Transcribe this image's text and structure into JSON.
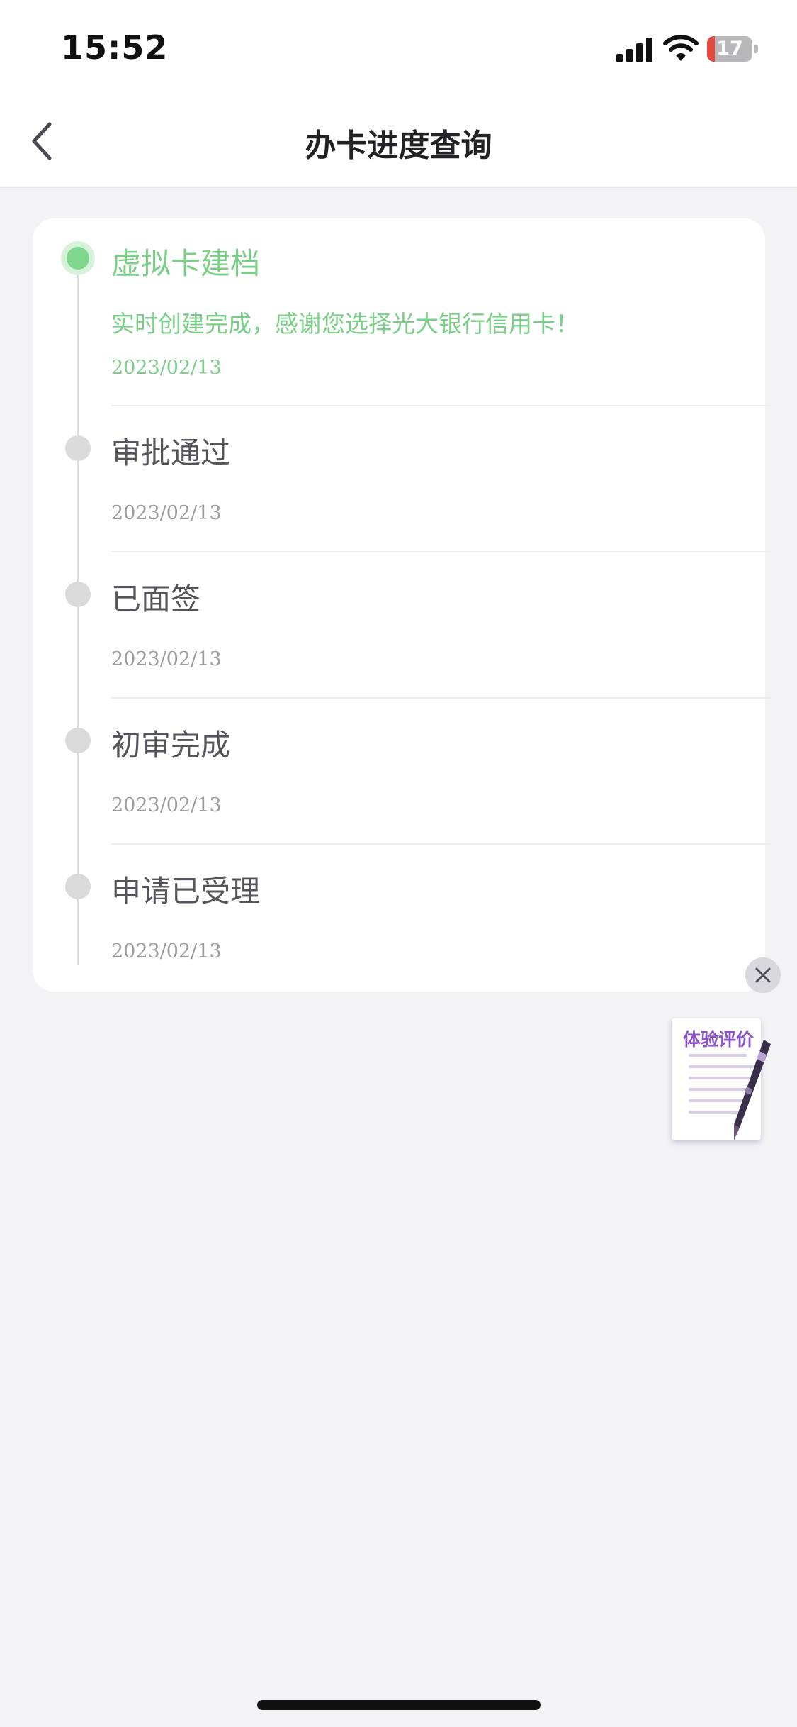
{
  "status_bar": {
    "time": "15:52",
    "battery_level": "17",
    "battery_fraction": 0.17,
    "icons": [
      "signal-icon",
      "wifi-icon",
      "battery-icon"
    ]
  },
  "nav": {
    "title": "办卡进度查询",
    "back_icon": "chevron-left-icon"
  },
  "timeline": {
    "steps": [
      {
        "title": "虚拟卡建档",
        "desc": "实时创建完成，感谢您选择光大银行信用卡！",
        "date": "2023/02/13",
        "active": true
      },
      {
        "title": "审批通过",
        "date": "2023/02/13",
        "active": false
      },
      {
        "title": "已面签",
        "date": "2023/02/13",
        "active": false
      },
      {
        "title": "初审完成",
        "date": "2023/02/13",
        "active": false
      },
      {
        "title": "申请已受理",
        "date": "2023/02/13",
        "active": false
      }
    ]
  },
  "feedback": {
    "label": "体验评价",
    "close_icon": "close-icon",
    "icon": "document-pen-icon"
  },
  "colors": {
    "active_green": "#79cf85",
    "inactive_dot": "#dadada",
    "page_bg": "#f3f3f6",
    "feedback_purple": "#8c53c6"
  }
}
